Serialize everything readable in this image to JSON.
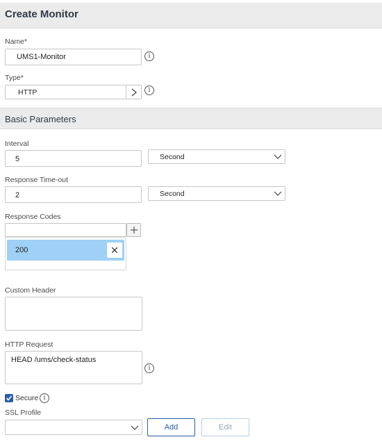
{
  "header": {
    "title": "Create Monitor"
  },
  "name": {
    "label": "Name*",
    "value": "UMS1-Monitor"
  },
  "type": {
    "label": "Type*",
    "value": "HTTP"
  },
  "section": {
    "title": "Basic Parameters"
  },
  "interval": {
    "label": "Interval",
    "value": "5",
    "unit": "Second"
  },
  "timeout": {
    "label": "Response Time-out",
    "value": "2",
    "unit": "Second"
  },
  "response_codes": {
    "label": "Response Codes",
    "input_value": "",
    "items": [
      "200"
    ]
  },
  "custom_header": {
    "label": "Custom Header",
    "value": ""
  },
  "http_request": {
    "label": "HTTP Request",
    "value": "HEAD /ums/check-status"
  },
  "secure": {
    "label": "Secure",
    "checked": true
  },
  "ssl_profile": {
    "label": "SSL Profile",
    "value": ""
  },
  "buttons": {
    "add": "Add",
    "edit": "Edit"
  },
  "colors": {
    "accent": "#2a5da8",
    "chip_bg": "#9fd0f5"
  },
  "icons": [
    "info-icon",
    "chevron-right-icon",
    "chevron-down-icon",
    "plus-icon",
    "close-icon",
    "checkbox-checked-icon"
  ]
}
